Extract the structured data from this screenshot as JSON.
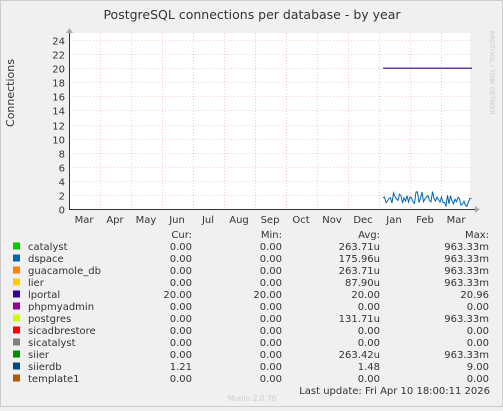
{
  "chart_data": {
    "type": "line",
    "title": "PostgreSQL connections per database - by year",
    "ylabel": "Connections",
    "ylim": [
      0,
      25
    ],
    "yticks": [
      0,
      2,
      4,
      6,
      8,
      10,
      12,
      14,
      16,
      18,
      20,
      22,
      24
    ],
    "xticks": [
      "Mar",
      "Apr",
      "May",
      "Jun",
      "Jul",
      "Aug",
      "Sep",
      "Oct",
      "Nov",
      "Dec",
      "Jan",
      "Feb",
      "Mar"
    ],
    "grid": true,
    "series": [
      {
        "name": "lportal",
        "color": "#330099",
        "x": [
          "Jan",
          "Mar"
        ],
        "values": [
          20,
          20
        ]
      },
      {
        "name": "siierdb",
        "color": "#0066b3",
        "x": [
          "Jan",
          "Feb",
          "Mar"
        ],
        "values": [
          1.6,
          1.2,
          1.21
        ]
      }
    ]
  },
  "watermark": "RRDTOOL / TOBI OETIKER",
  "legend": {
    "headers": [
      "Cur:",
      "Min:",
      "Avg:",
      "Max:"
    ],
    "rows": [
      {
        "name": "catalyst",
        "color": "#00cc00",
        "cur": "0.00",
        "min": "0.00",
        "avg": "263.71u",
        "max": "963.33m"
      },
      {
        "name": "dspace",
        "color": "#0066b3",
        "cur": "0.00",
        "min": "0.00",
        "avg": "175.96u",
        "max": "963.33m"
      },
      {
        "name": "guacamole_db",
        "color": "#ff8000",
        "cur": "0.00",
        "min": "0.00",
        "avg": "263.71u",
        "max": "963.33m"
      },
      {
        "name": "lier",
        "color": "#ffcc00",
        "cur": "0.00",
        "min": "0.00",
        "avg": "87.90u",
        "max": "963.33m"
      },
      {
        "name": "lportal",
        "color": "#330099",
        "cur": "20.00",
        "min": "20.00",
        "avg": "20.00",
        "max": "20.96"
      },
      {
        "name": "phpmyadmin",
        "color": "#990099",
        "cur": "0.00",
        "min": "0.00",
        "avg": "0.00",
        "max": "0.00"
      },
      {
        "name": "postgres",
        "color": "#ccff00",
        "cur": "0.00",
        "min": "0.00",
        "avg": "131.71u",
        "max": "963.33m"
      },
      {
        "name": "sicadbrestore",
        "color": "#ff0000",
        "cur": "0.00",
        "min": "0.00",
        "avg": "0.00",
        "max": "0.00"
      },
      {
        "name": "sicatalyst",
        "color": "#808080",
        "cur": "0.00",
        "min": "0.00",
        "avg": "0.00",
        "max": "0.00"
      },
      {
        "name": "siier",
        "color": "#008f00",
        "cur": "0.00",
        "min": "0.00",
        "avg": "263.42u",
        "max": "963.33m"
      },
      {
        "name": "siierdb",
        "color": "#00487d",
        "cur": "1.21",
        "min": "0.00",
        "avg": "1.48",
        "max": "9.00"
      },
      {
        "name": "template1",
        "color": "#b35a00",
        "cur": "0.00",
        "min": "0.00",
        "avg": "0.00",
        "max": "0.00"
      }
    ]
  },
  "last_update": "Last update: Fri Apr 10 18:00:11 2026",
  "footer": "Munin 2.0.76"
}
